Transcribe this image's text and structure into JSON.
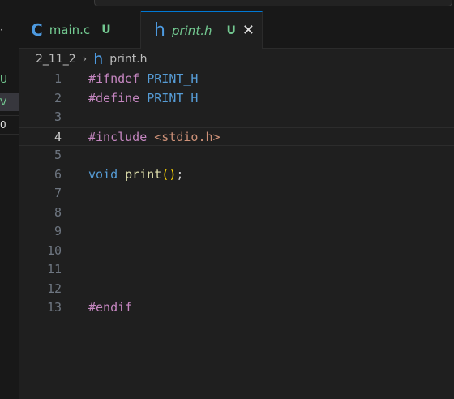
{
  "tabs": [
    {
      "icon": "C",
      "label": "main.c",
      "badge": "U"
    },
    {
      "icon": "h",
      "label": "print.h",
      "badge": "U",
      "close": "✕"
    }
  ],
  "breadcrumb": {
    "folder": "2_11_2",
    "separator": "›",
    "file_icon": "h",
    "file": "print.h"
  },
  "sidebar": {
    "fragments": [
      "·",
      "U",
      "V",
      "0"
    ]
  },
  "editor": {
    "current_line": 4,
    "lines": [
      {
        "num": "1",
        "tokens": [
          {
            "t": "#ifndef ",
            "c": "pre"
          },
          {
            "t": "PRINT_H",
            "c": "mac"
          }
        ]
      },
      {
        "num": "2",
        "tokens": [
          {
            "t": "#define ",
            "c": "pre"
          },
          {
            "t": "PRINT_H",
            "c": "mac"
          }
        ]
      },
      {
        "num": "3",
        "tokens": []
      },
      {
        "num": "4",
        "tokens": [
          {
            "t": "#include ",
            "c": "pre"
          },
          {
            "t": "<stdio.h>",
            "c": "str"
          }
        ]
      },
      {
        "num": "5",
        "tokens": []
      },
      {
        "num": "6",
        "tokens": [
          {
            "t": "void",
            "c": "kw"
          },
          {
            "t": " ",
            "c": "pl"
          },
          {
            "t": "print",
            "c": "fn"
          },
          {
            "t": "()",
            "c": "br"
          },
          {
            "t": ";",
            "c": "pl"
          }
        ]
      },
      {
        "num": "7",
        "tokens": []
      },
      {
        "num": "8",
        "tokens": []
      },
      {
        "num": "9",
        "tokens": []
      },
      {
        "num": "10",
        "tokens": []
      },
      {
        "num": "11",
        "tokens": []
      },
      {
        "num": "12",
        "tokens": []
      },
      {
        "num": "13",
        "tokens": [
          {
            "t": "#endif",
            "c": "pre"
          }
        ]
      }
    ]
  }
}
